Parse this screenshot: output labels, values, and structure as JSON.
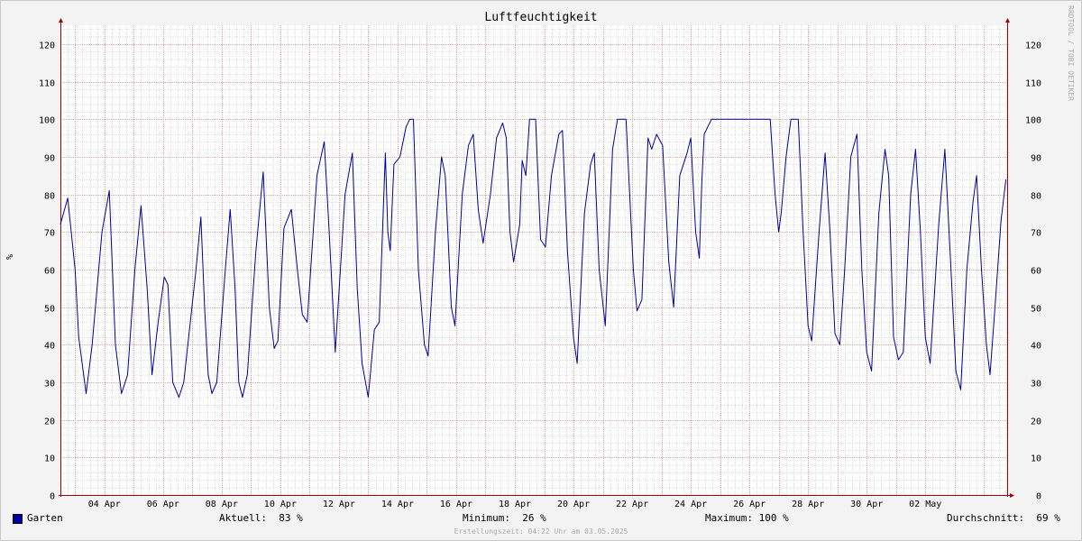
{
  "chart_data": {
    "type": "line",
    "title": "Luftfeuchtigkeit",
    "ylabel": "%",
    "ylim": [
      0,
      125
    ],
    "yticks": [
      0,
      10,
      20,
      30,
      40,
      50,
      60,
      70,
      80,
      90,
      100,
      110,
      120
    ],
    "xlim": [
      "2025-04-02 12:00",
      "2025-05-03 04:22"
    ],
    "xtick_labels": [
      {
        "date": "2025-04-04",
        "label": "04 Apr"
      },
      {
        "date": "2025-04-06",
        "label": "06 Apr"
      },
      {
        "date": "2025-04-08",
        "label": "08 Apr"
      },
      {
        "date": "2025-04-10",
        "label": "10 Apr"
      },
      {
        "date": "2025-04-12",
        "label": "12 Apr"
      },
      {
        "date": "2025-04-14",
        "label": "14 Apr"
      },
      {
        "date": "2025-04-16",
        "label": "16 Apr"
      },
      {
        "date": "2025-04-18",
        "label": "18 Apr"
      },
      {
        "date": "2025-04-20",
        "label": "20 Apr"
      },
      {
        "date": "2025-04-22",
        "label": "22 Apr"
      },
      {
        "date": "2025-04-24",
        "label": "24 Apr"
      },
      {
        "date": "2025-04-26",
        "label": "26 Apr"
      },
      {
        "date": "2025-04-28",
        "label": "28 Apr"
      },
      {
        "date": "2025-04-30",
        "label": "30 Apr"
      },
      {
        "date": "2025-05-02",
        "label": "02 May"
      }
    ],
    "grid": true,
    "series": [
      {
        "name": "Garten",
        "color": "#0000a0",
        "points": [
          [
            "2025-04-02 12:00",
            72
          ],
          [
            "2025-04-02 18:00",
            79
          ],
          [
            "2025-04-03 00:00",
            60
          ],
          [
            "2025-04-03 03:00",
            42
          ],
          [
            "2025-04-03 09:00",
            27
          ],
          [
            "2025-04-03 14:00",
            40
          ],
          [
            "2025-04-03 22:00",
            70
          ],
          [
            "2025-04-04 04:00",
            81
          ],
          [
            "2025-04-04 09:00",
            40
          ],
          [
            "2025-04-04 14:00",
            27
          ],
          [
            "2025-04-04 19:00",
            32
          ],
          [
            "2025-04-05 01:00",
            60
          ],
          [
            "2025-04-05 06:00",
            77
          ],
          [
            "2025-04-05 11:00",
            55
          ],
          [
            "2025-04-05 15:00",
            32
          ],
          [
            "2025-04-05 20:00",
            46
          ],
          [
            "2025-04-06 01:00",
            58
          ],
          [
            "2025-04-06 04:00",
            56
          ],
          [
            "2025-04-06 08:00",
            30
          ],
          [
            "2025-04-06 13:00",
            26
          ],
          [
            "2025-04-06 17:00",
            30
          ],
          [
            "2025-04-07 03:00",
            60
          ],
          [
            "2025-04-07 07:00",
            74
          ],
          [
            "2025-04-07 10:00",
            50
          ],
          [
            "2025-04-07 13:00",
            32
          ],
          [
            "2025-04-07 16:00",
            27
          ],
          [
            "2025-04-07 20:00",
            30
          ],
          [
            "2025-04-08 03:00",
            60
          ],
          [
            "2025-04-08 07:00",
            76
          ],
          [
            "2025-04-08 11:00",
            55
          ],
          [
            "2025-04-08 14:00",
            30
          ],
          [
            "2025-04-08 17:00",
            26
          ],
          [
            "2025-04-08 21:00",
            32
          ],
          [
            "2025-04-09 04:00",
            65
          ],
          [
            "2025-04-09 10:00",
            86
          ],
          [
            "2025-04-09 15:00",
            50
          ],
          [
            "2025-04-09 19:00",
            39
          ],
          [
            "2025-04-09 22:00",
            41
          ],
          [
            "2025-04-10 03:00",
            71
          ],
          [
            "2025-04-10 09:00",
            76
          ],
          [
            "2025-04-10 14:00",
            60
          ],
          [
            "2025-04-10 18:00",
            48
          ],
          [
            "2025-04-10 22:00",
            46
          ],
          [
            "2025-04-11 06:00",
            85
          ],
          [
            "2025-04-11 12:00",
            94
          ],
          [
            "2025-04-11 16:00",
            70
          ],
          [
            "2025-04-11 21:00",
            38
          ],
          [
            "2025-04-12 05:00",
            80
          ],
          [
            "2025-04-12 11:00",
            91
          ],
          [
            "2025-04-12 15:00",
            55
          ],
          [
            "2025-04-12 19:00",
            35
          ],
          [
            "2025-04-13 00:00",
            26
          ],
          [
            "2025-04-13 05:00",
            44
          ],
          [
            "2025-04-13 09:00",
            46
          ],
          [
            "2025-04-13 14:00",
            91
          ],
          [
            "2025-04-13 16:00",
            70
          ],
          [
            "2025-04-13 18:00",
            65
          ],
          [
            "2025-04-13 21:00",
            88
          ],
          [
            "2025-04-14 02:00",
            90
          ],
          [
            "2025-04-14 07:00",
            98
          ],
          [
            "2025-04-14 10:00",
            100
          ],
          [
            "2025-04-14 13:00",
            100
          ],
          [
            "2025-04-14 17:00",
            60
          ],
          [
            "2025-04-14 22:00",
            40
          ],
          [
            "2025-04-15 01:00",
            37
          ],
          [
            "2025-04-15 07:00",
            70
          ],
          [
            "2025-04-15 12:00",
            90
          ],
          [
            "2025-04-15 15:00",
            85
          ],
          [
            "2025-04-15 20:00",
            50
          ],
          [
            "2025-04-15 23:00",
            45
          ],
          [
            "2025-04-16 05:00",
            80
          ],
          [
            "2025-04-16 10:00",
            93
          ],
          [
            "2025-04-16 14:00",
            96
          ],
          [
            "2025-04-16 18:00",
            76
          ],
          [
            "2025-04-16 22:00",
            67
          ],
          [
            "2025-04-17 04:00",
            80
          ],
          [
            "2025-04-17 09:00",
            95
          ],
          [
            "2025-04-17 14:00",
            99
          ],
          [
            "2025-04-17 17:00",
            95
          ],
          [
            "2025-04-17 20:00",
            70
          ],
          [
            "2025-04-17 23:00",
            62
          ],
          [
            "2025-04-18 04:00",
            72
          ],
          [
            "2025-04-18 06:00",
            89
          ],
          [
            "2025-04-18 09:00",
            85
          ],
          [
            "2025-04-18 12:00",
            100
          ],
          [
            "2025-04-18 17:00",
            100
          ],
          [
            "2025-04-18 21:00",
            68
          ],
          [
            "2025-04-19 01:00",
            66
          ],
          [
            "2025-04-19 06:00",
            85
          ],
          [
            "2025-04-19 12:00",
            96
          ],
          [
            "2025-04-19 15:00",
            97
          ],
          [
            "2025-04-19 19:00",
            65
          ],
          [
            "2025-04-20 00:00",
            42
          ],
          [
            "2025-04-20 03:00",
            35
          ],
          [
            "2025-04-20 09:00",
            75
          ],
          [
            "2025-04-20 14:00",
            88
          ],
          [
            "2025-04-20 17:00",
            91
          ],
          [
            "2025-04-20 21:00",
            60
          ],
          [
            "2025-04-21 02:00",
            45
          ],
          [
            "2025-04-21 08:00",
            92
          ],
          [
            "2025-04-21 12:00",
            100
          ],
          [
            "2025-04-21 19:00",
            100
          ],
          [
            "2025-04-22 01:00",
            60
          ],
          [
            "2025-04-22 04:00",
            49
          ],
          [
            "2025-04-22 08:00",
            52
          ],
          [
            "2025-04-22 13:00",
            95
          ],
          [
            "2025-04-22 16:00",
            92
          ],
          [
            "2025-04-22 20:00",
            96
          ],
          [
            "2025-04-23 01:00",
            93
          ],
          [
            "2025-04-23 06:00",
            62
          ],
          [
            "2025-04-23 10:00",
            50
          ],
          [
            "2025-04-23 15:00",
            85
          ],
          [
            "2025-04-23 21:00",
            91
          ],
          [
            "2025-04-24 00:00",
            95
          ],
          [
            "2025-04-24 04:00",
            70
          ],
          [
            "2025-04-24 07:00",
            63
          ],
          [
            "2025-04-24 09:00",
            83
          ],
          [
            "2025-04-24 11:00",
            96
          ],
          [
            "2025-04-24 17:00",
            100
          ],
          [
            "2025-04-26 17:00",
            100
          ],
          [
            "2025-04-26 21:00",
            80
          ],
          [
            "2025-04-27 00:00",
            70
          ],
          [
            "2025-04-27 02:00",
            75
          ],
          [
            "2025-04-27 06:00",
            90
          ],
          [
            "2025-04-27 10:00",
            100
          ],
          [
            "2025-04-27 16:00",
            100
          ],
          [
            "2025-04-27 20:00",
            70
          ],
          [
            "2025-04-28 00:00",
            45
          ],
          [
            "2025-04-28 03:00",
            41
          ],
          [
            "2025-04-28 09:00",
            70
          ],
          [
            "2025-04-28 14:00",
            91
          ],
          [
            "2025-04-28 18:00",
            70
          ],
          [
            "2025-04-28 22:00",
            43
          ],
          [
            "2025-04-29 02:00",
            40
          ],
          [
            "2025-04-29 06:00",
            60
          ],
          [
            "2025-04-29 11:00",
            90
          ],
          [
            "2025-04-29 16:00",
            96
          ],
          [
            "2025-04-29 20:00",
            60
          ],
          [
            "2025-04-30 00:00",
            38
          ],
          [
            "2025-04-30 04:00",
            33
          ],
          [
            "2025-04-30 10:00",
            75
          ],
          [
            "2025-04-30 15:00",
            92
          ],
          [
            "2025-04-30 18:00",
            85
          ],
          [
            "2025-04-30 22:00",
            42
          ],
          [
            "2025-05-01 02:00",
            36
          ],
          [
            "2025-05-01 06:00",
            38
          ],
          [
            "2025-05-01 12:00",
            80
          ],
          [
            "2025-05-01 16:00",
            92
          ],
          [
            "2025-05-01 20:00",
            70
          ],
          [
            "2025-05-02 00:00",
            42
          ],
          [
            "2025-05-02 04:00",
            35
          ],
          [
            "2025-05-02 11:00",
            72
          ],
          [
            "2025-05-02 16:00",
            92
          ],
          [
            "2025-05-02 21:00",
            60
          ],
          [
            "2025-05-03 01:00",
            33
          ],
          [
            "2025-05-03 05:00",
            28
          ],
          [
            "2025-05-03 10:00",
            60
          ],
          [
            "2025-05-03 15:00",
            78
          ],
          [
            "2025-05-03 18:00",
            85
          ],
          [
            "2025-05-03 22:00",
            60
          ],
          [
            "2025-05-04 02:00",
            40
          ],
          [
            "2025-05-04 05:00",
            32
          ],
          [
            "2025-05-04 09:00",
            50
          ],
          [
            "2025-05-04 14:00",
            73
          ],
          [
            "2025-05-04 18:00",
            84
          ]
        ]
      }
    ]
  },
  "legend": {
    "series_name": "Garten",
    "current": "Aktuell:  83 %",
    "minimum": "Minimum:  26 %",
    "maximum": "Maximum: 100 %",
    "average": "Durchschnitt:  69 %"
  },
  "footer": "Erstellungszeit: 04:22 Uhr am 03.05.2025",
  "watermark": "RRDTOOL / TOBI OETIKER",
  "colors": {
    "background": "#f3f3f3",
    "canvas": "#ffffff",
    "line": "#0000a0",
    "major_grid": "#e0a0a0",
    "minor_grid": "#dddddd",
    "axis": "#a00000"
  }
}
